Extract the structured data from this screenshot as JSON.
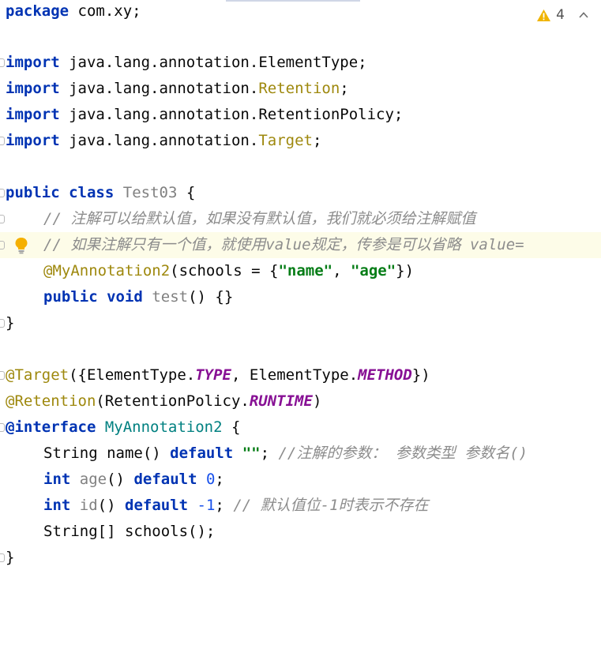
{
  "inspection": {
    "warning_count": "4",
    "warning_icon": "warning-triangle-icon",
    "collapse_icon": "chevron-up-icon",
    "warning_color": "#f0b400"
  },
  "code": {
    "l1": {
      "kw": "package",
      "rest": " com.xy;"
    },
    "l2": {
      "kw": "import",
      "pkg": " java.lang.annotation.",
      "cls": "ElementType",
      "end": ";"
    },
    "l3": {
      "kw": "import",
      "pkg": " java.lang.annotation.",
      "cls": "Retention",
      "end": ";"
    },
    "l4": {
      "kw": "import",
      "pkg": " java.lang.annotation.",
      "cls": "RetentionPolicy",
      "end": ";"
    },
    "l5": {
      "kw": "import",
      "pkg": " java.lang.annotation.",
      "cls": "Target",
      "end": ";"
    },
    "l6": {
      "kw1": "public",
      "kw2": "class",
      "name": "Test03",
      "brace": " {"
    },
    "l7": {
      "comment": "// 注解可以给默认值，如果没有默认值，我们就必须给注解赋值"
    },
    "l8": {
      "comment": "// 如果注解只有一个值，就使用value规定，传参是可以省略 value="
    },
    "l9": {
      "anno": "@MyAnnotation2",
      "open": "(schools = {",
      "s1": "\"name\"",
      "sep": ", ",
      "s2": "\"age\"",
      "close": "})"
    },
    "l10": {
      "kw1": "public",
      "kw2": "void",
      "name": "test",
      "rest": "() {}"
    },
    "l11": {
      "brace": "}"
    },
    "l12": {
      "anno": "@Target",
      "a": "({ElementType.",
      "f1": "TYPE",
      "b": ", ElementType.",
      "f2": "METHOD",
      "c": "})"
    },
    "l13": {
      "anno": "@Retention",
      "a": "(RetentionPolicy.",
      "f1": "RUNTIME",
      "c": ")"
    },
    "l14": {
      "kw": "@interface",
      "name": "MyAnnotation2",
      "brace": " {"
    },
    "l15": {
      "type": "String name() ",
      "kw": "default",
      "str": "\"\"",
      "semi": "; ",
      "comment": "//注解的参数： 参数类型 参数名()"
    },
    "l16": {
      "kw1": "int",
      "name": "age",
      "paren": "() ",
      "kw2": "default",
      "num": "0",
      "semi": ";"
    },
    "l17": {
      "kw1": "int",
      "name": "id",
      "paren": "() ",
      "kw2": "default",
      "num": "-1",
      "semi": "; ",
      "comment": "// 默认值位-1时表示不存在"
    },
    "l18": {
      "type": "String[] schools();"
    },
    "l19": {
      "brace": "}"
    }
  }
}
